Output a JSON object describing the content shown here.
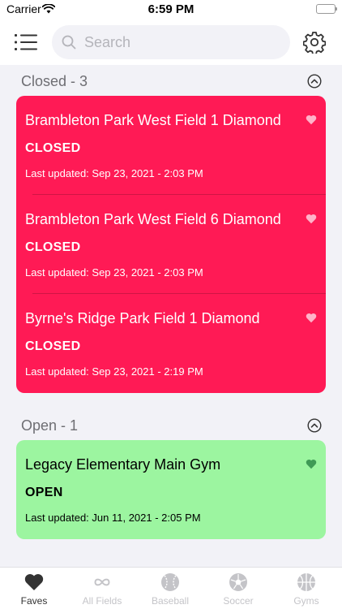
{
  "status_bar": {
    "carrier": "Carrier",
    "time": "6:59 PM"
  },
  "search": {
    "placeholder": "Search"
  },
  "sections": {
    "closed": {
      "title": "Closed - 3",
      "items": [
        {
          "name": "Brambleton Park West Field 1 Diamond",
          "status": "CLOSED",
          "updated": "Last updated: Sep 23, 2021 - 2:03 PM"
        },
        {
          "name": "Brambleton Park West Field 6 Diamond",
          "status": "CLOSED",
          "updated": "Last updated: Sep 23, 2021 - 2:03 PM"
        },
        {
          "name": "Byrne's Ridge Park Field 1 Diamond",
          "status": "CLOSED",
          "updated": "Last updated: Sep 23, 2021 - 2:19 PM"
        }
      ]
    },
    "open": {
      "title": "Open - 1",
      "items": [
        {
          "name": "Legacy Elementary Main Gym",
          "status": "OPEN",
          "updated": "Last updated: Jun 11, 2021 - 2:05 PM"
        }
      ]
    }
  },
  "tabs": [
    {
      "label": "Faves",
      "icon": "heart-icon"
    },
    {
      "label": "All Fields",
      "icon": "infinity-icon"
    },
    {
      "label": "Baseball",
      "icon": "baseball-icon"
    },
    {
      "label": "Soccer",
      "icon": "soccer-ball-icon"
    },
    {
      "label": "Gyms",
      "icon": "basketball-icon"
    }
  ],
  "colors": {
    "closed_card": "#ff1a55",
    "open_card": "#9cf5a0",
    "closed_heart": "#ffb3c9",
    "open_heart": "#3f9a55",
    "active_tab": "#333333",
    "inactive_tab": "#c4c4c8"
  }
}
